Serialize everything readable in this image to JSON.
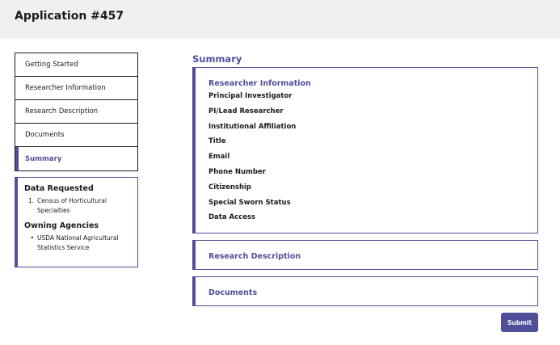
{
  "header": {
    "title": "Application #457"
  },
  "sidebar": {
    "nav": [
      {
        "label": "Getting Started",
        "active": false
      },
      {
        "label": "Researcher Information",
        "active": false
      },
      {
        "label": "Research Description",
        "active": false
      },
      {
        "label": "Documents",
        "active": false
      },
      {
        "label": "Summary",
        "active": true
      }
    ],
    "info": {
      "data_requested_heading": "Data Requested",
      "data_requested": [
        {
          "marker": "1.",
          "text": "Census of Horticultural Specialties"
        }
      ],
      "owning_agencies_heading": "Owning Agencies",
      "owning_agencies": [
        {
          "marker": "•",
          "text": "USDA National Agricultural Statistics Service"
        }
      ]
    }
  },
  "main": {
    "title": "Summary",
    "researcher": {
      "heading": "Researcher Information",
      "fields": [
        "Principal Investigator",
        "PI/Lead Researcher",
        "Institutional Affiliation",
        "Title",
        "Email",
        "Phone Number",
        "Citizenship",
        "Special Sworn Status",
        "Data Access"
      ]
    },
    "research_description": {
      "heading": "Research Description"
    },
    "documents": {
      "heading": "Documents"
    },
    "submit_label": "Submit"
  },
  "colors": {
    "accent": "#4f4f9a",
    "header_bg": "#f0f0f0",
    "text": "#1b1b1b"
  }
}
